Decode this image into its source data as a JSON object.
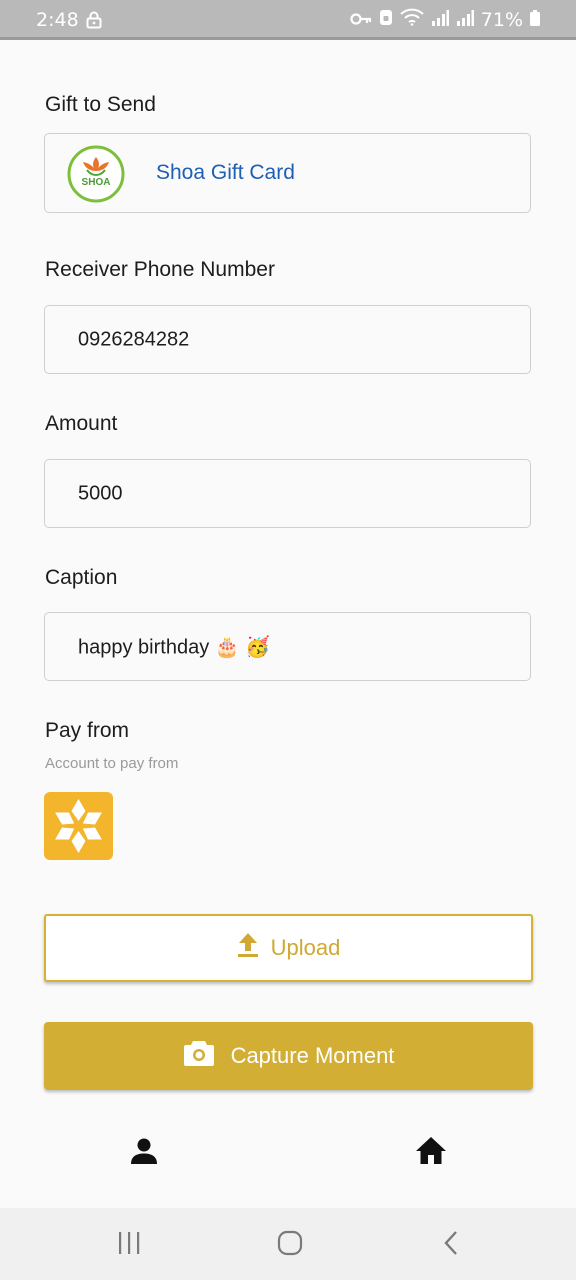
{
  "status_bar": {
    "time": "2:48",
    "battery": "71%"
  },
  "form": {
    "gift_label": "Gift to Send",
    "gift_name": "Shoa Gift Card",
    "gift_logo_text": "SHOA",
    "phone_label": "Receiver Phone Number",
    "phone_value": "0926284282",
    "amount_label": "Amount",
    "amount_value": "5000",
    "caption_label": "Caption",
    "caption_value": "happy birthday 🎂 🥳",
    "pay_from_label": "Pay from",
    "pay_from_sublabel": "Account to pay from"
  },
  "actions": {
    "upload_label": "Upload",
    "capture_label": "Capture Moment"
  },
  "bottom_tabs": [
    "person-icon",
    "home-icon"
  ],
  "colors": {
    "accent": "#d3ae35",
    "link": "#1f5fb3",
    "account_tile": "#f3b52c"
  }
}
